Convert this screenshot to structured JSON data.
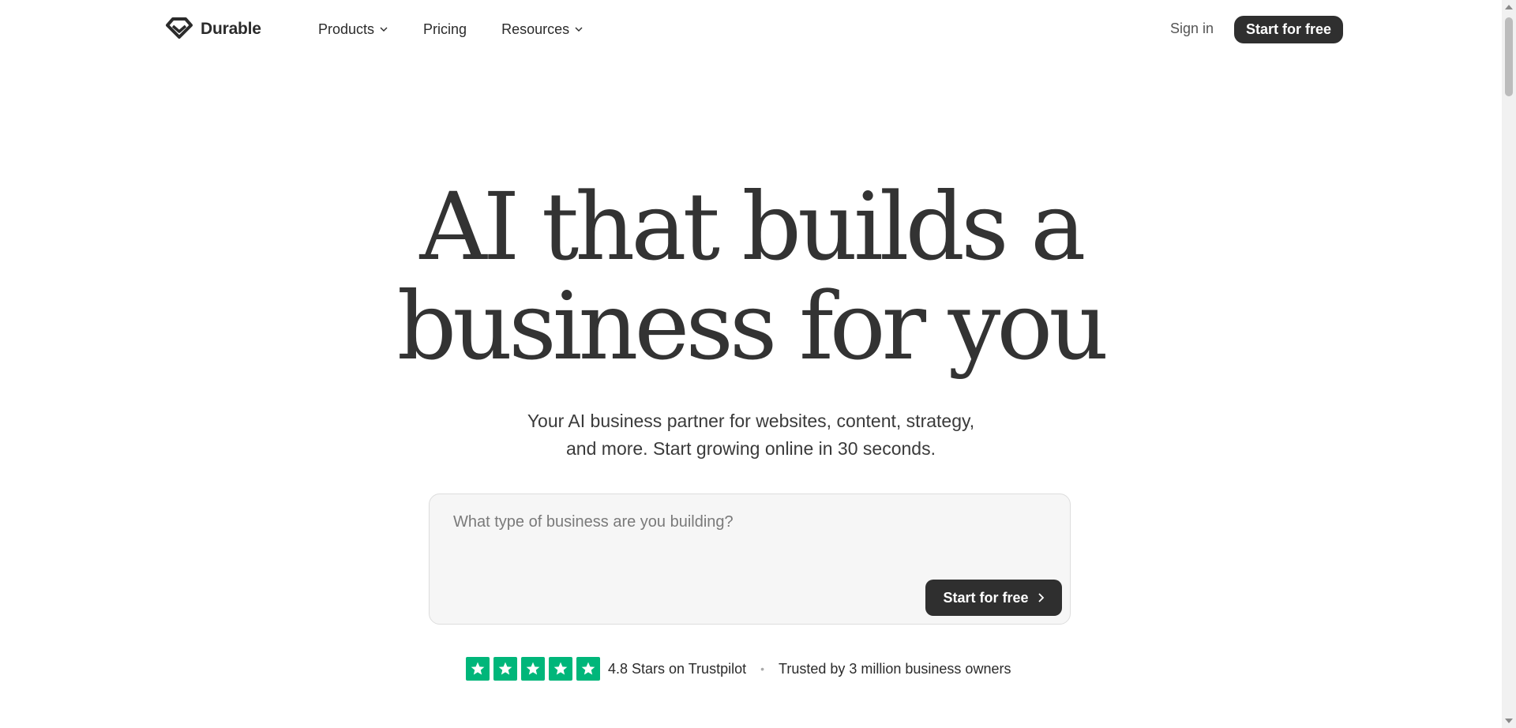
{
  "nav": {
    "logo_text": "Durable",
    "items": [
      {
        "label": "Products",
        "has_dropdown": true
      },
      {
        "label": "Pricing",
        "has_dropdown": false
      },
      {
        "label": "Resources",
        "has_dropdown": true
      }
    ],
    "sign_in": "Sign in",
    "cta": "Start for free"
  },
  "hero": {
    "title_line1": "AI that builds a",
    "title_line2": "business for you",
    "subtitle_line1": "Your AI business partner for websites, content, strategy,",
    "subtitle_line2": "and more. Start growing online in 30 seconds."
  },
  "prompt": {
    "placeholder": "What type of business are you building?",
    "value": "",
    "cta": "Start for free"
  },
  "trust": {
    "stars_count": 5,
    "rating_text": "4.8 Stars on Trustpilot",
    "separator": "•",
    "trusted_text": "Trusted by 3 million business owners"
  },
  "colors": {
    "button_dark": "#2f2f2f",
    "trustpilot_green": "#00b67a",
    "text": "#2b2b2b"
  }
}
